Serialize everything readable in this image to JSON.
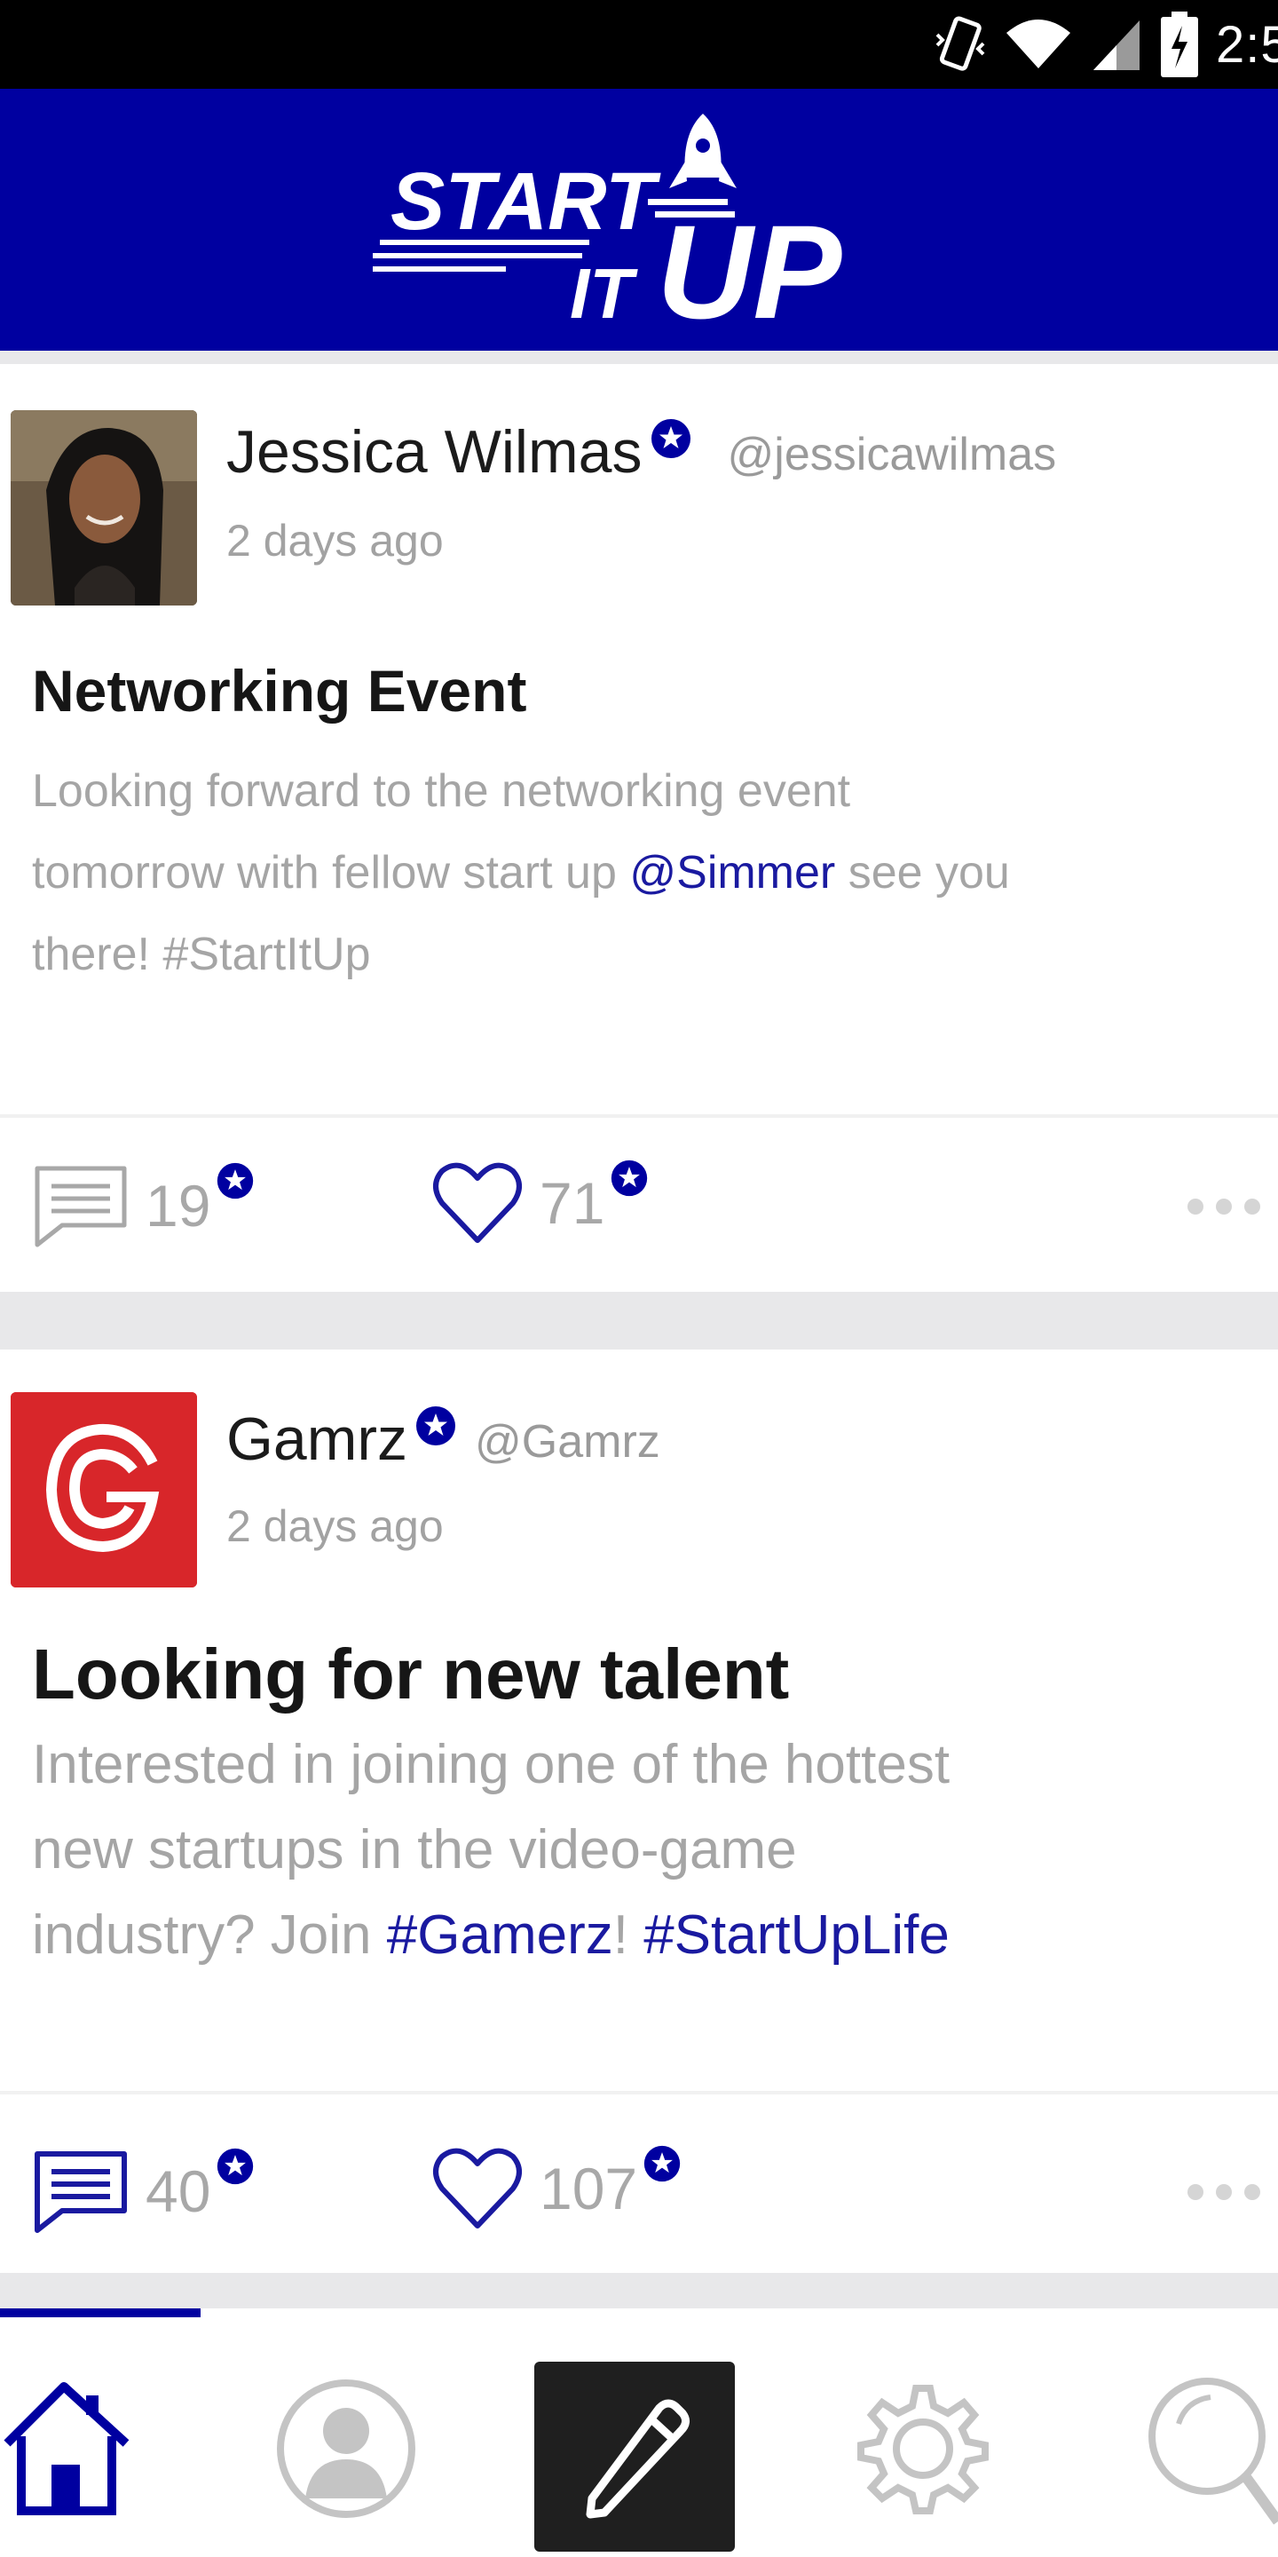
{
  "status_bar": {
    "time": "2:5",
    "icons": [
      "vibrate-icon",
      "wifi-icon",
      "signal-icon",
      "battery-icon"
    ]
  },
  "app": {
    "logo_text_1": "START",
    "logo_text_2": "IT",
    "logo_text_3": "UP",
    "brand_color": "#0000a0"
  },
  "posts": [
    {
      "author": "Jessica Wilmas",
      "handle": "@jessicawilmas",
      "time": "2 days ago",
      "title": "Networking Event",
      "body_1": "Looking forward to the networking event",
      "body_2a": "tomorrow with fellow start up ",
      "body_2b": "@Simmer",
      "body_2c": " see you",
      "body_3": "there! #StartItUp",
      "comments": "19",
      "likes": "71"
    },
    {
      "author": "Gamrz",
      "handle": "@Gamrz",
      "time": "2 days ago",
      "title": "Looking for new talent",
      "body_1": "Interested in joining one of the hottest",
      "body_2": "new startups in the video-game",
      "body_3a": "industry? Join ",
      "body_3b": "#Gamerz",
      "body_3c": "! ",
      "body_3d": "#StartUpLife",
      "comments": "40",
      "likes": "107"
    }
  ],
  "nav": [
    "home-icon",
    "profile-icon",
    "compose-icon",
    "settings-icon",
    "search-icon"
  ]
}
